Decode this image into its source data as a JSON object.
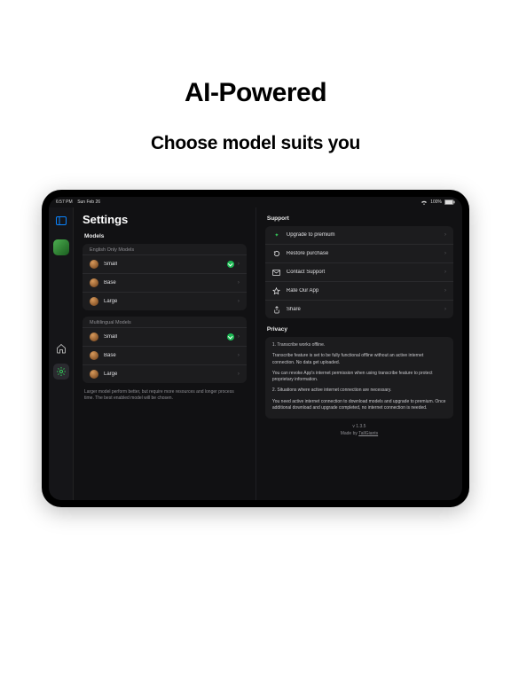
{
  "marketing": {
    "headline": "AI-Powered",
    "subheadline": "Choose model suits you"
  },
  "statusbar": {
    "time": "6:57 PM",
    "date": "Sun Feb 26",
    "battery": "100%"
  },
  "settings": {
    "title": "Settings",
    "models": {
      "section": "Models",
      "note": "Larger model perform better, but require more resources and longer process time. The best enabled model will be chosen.",
      "english": {
        "group": "English Only Models",
        "items": [
          {
            "name": "Small",
            "downloaded": true
          },
          {
            "name": "Base",
            "downloaded": false
          },
          {
            "name": "Large",
            "downloaded": false
          }
        ]
      },
      "multilingual": {
        "group": "Multilingual Models",
        "items": [
          {
            "name": "Small",
            "downloaded": true
          },
          {
            "name": "Base",
            "downloaded": false
          },
          {
            "name": "Large",
            "downloaded": false
          }
        ]
      }
    },
    "support": {
      "section": "Support",
      "items": [
        {
          "icon": "sparkle",
          "label": "Upgrade to premium"
        },
        {
          "icon": "restore",
          "label": "Restore purchase"
        },
        {
          "icon": "mail",
          "label": "Contact Support"
        },
        {
          "icon": "star",
          "label": "Rate Our App"
        },
        {
          "icon": "share",
          "label": "Share"
        }
      ]
    },
    "privacy": {
      "section": "Privacy",
      "p1": "1. Transcribe works offline.",
      "p2": "Transcribe feature is set to be fully functional offline without an active internet connection. No data get uploaded.",
      "p3": "You can revoke App's internet permission when using transcribe feature to protect proprietary information.",
      "p4": "2. Situations where active internet connection are necessary.",
      "p5": "You need active internet connection to download models and upgrade to premium. Once additional download and upgrade completed, no internet connection is needed."
    },
    "footer": {
      "version": "v 1.3.5",
      "made_prefix": "Made by ",
      "made_link": "TallGiants"
    }
  }
}
